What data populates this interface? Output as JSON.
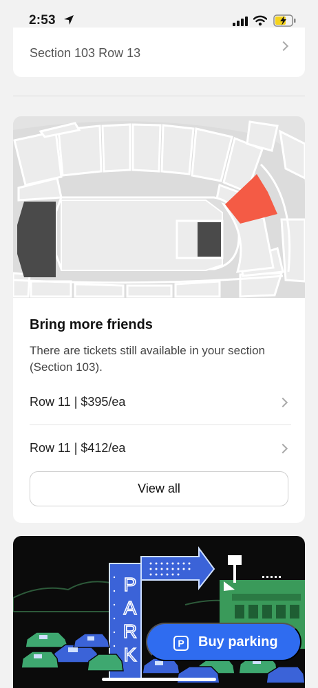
{
  "status_bar": {
    "time": "2:53"
  },
  "ticket_card": {
    "section_row": "Section 103 Row 13"
  },
  "seat_map": {
    "highlight_color": "#f45b45",
    "stage_color": "#4a4a4a"
  },
  "friends_card": {
    "title": "Bring more friends",
    "description": "There are tickets still available in your section (Section 103).",
    "offers": [
      {
        "label": "Row 11 | $395/ea"
      },
      {
        "label": "Row 11 | $412/ea"
      }
    ],
    "view_all_label": "View all"
  },
  "parking": {
    "sign_letters": [
      "P",
      "A",
      "R",
      "K"
    ],
    "buy_label": "Buy parking",
    "icon_letter": "P",
    "accent_color": "#2f6cf0"
  }
}
